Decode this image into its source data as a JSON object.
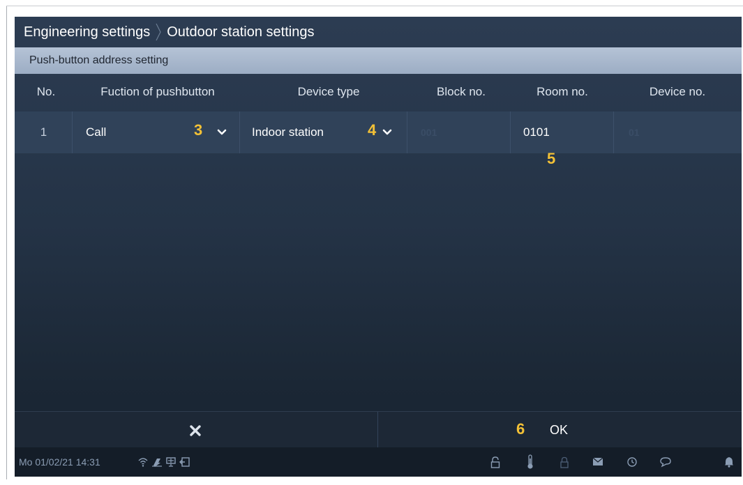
{
  "breadcrumb": {
    "level1": "Engineering settings",
    "level2": "Outdoor station settings"
  },
  "section": {
    "title": "Push-button address setting"
  },
  "table": {
    "headers": {
      "no": "No.",
      "function": "Fuction of pushbutton",
      "device_type": "Device type",
      "block_no": "Block no.",
      "room_no": "Room no.",
      "device_no": "Device no."
    },
    "rows": [
      {
        "no": "1",
        "function": "Call",
        "device_type": "Indoor station",
        "block_no": "001",
        "room_no": "0101",
        "device_no": "01"
      }
    ]
  },
  "markers": {
    "function_dropdown": "3",
    "device_type_dropdown": "4",
    "room_no_field": "5",
    "ok_button": "6"
  },
  "actions": {
    "ok_label": "OK"
  },
  "status": {
    "datetime": "Mo 01/02/21  14:31"
  },
  "icons": {
    "cancel": "close-icon",
    "dropdown": "chevron-down-icon",
    "status_left": [
      "wifi-icon",
      "mute-icon",
      "monitor-icon",
      "exit-icon"
    ],
    "status_right": [
      "unlock-icon",
      "thermometer-icon",
      "lock-icon",
      "mail-icon",
      "history-icon",
      "chat-icon",
      "bell-icon"
    ]
  },
  "colors": {
    "marker": "#f3c136",
    "section_bar": "#a8b8ce",
    "screen_bg": "#243346"
  }
}
